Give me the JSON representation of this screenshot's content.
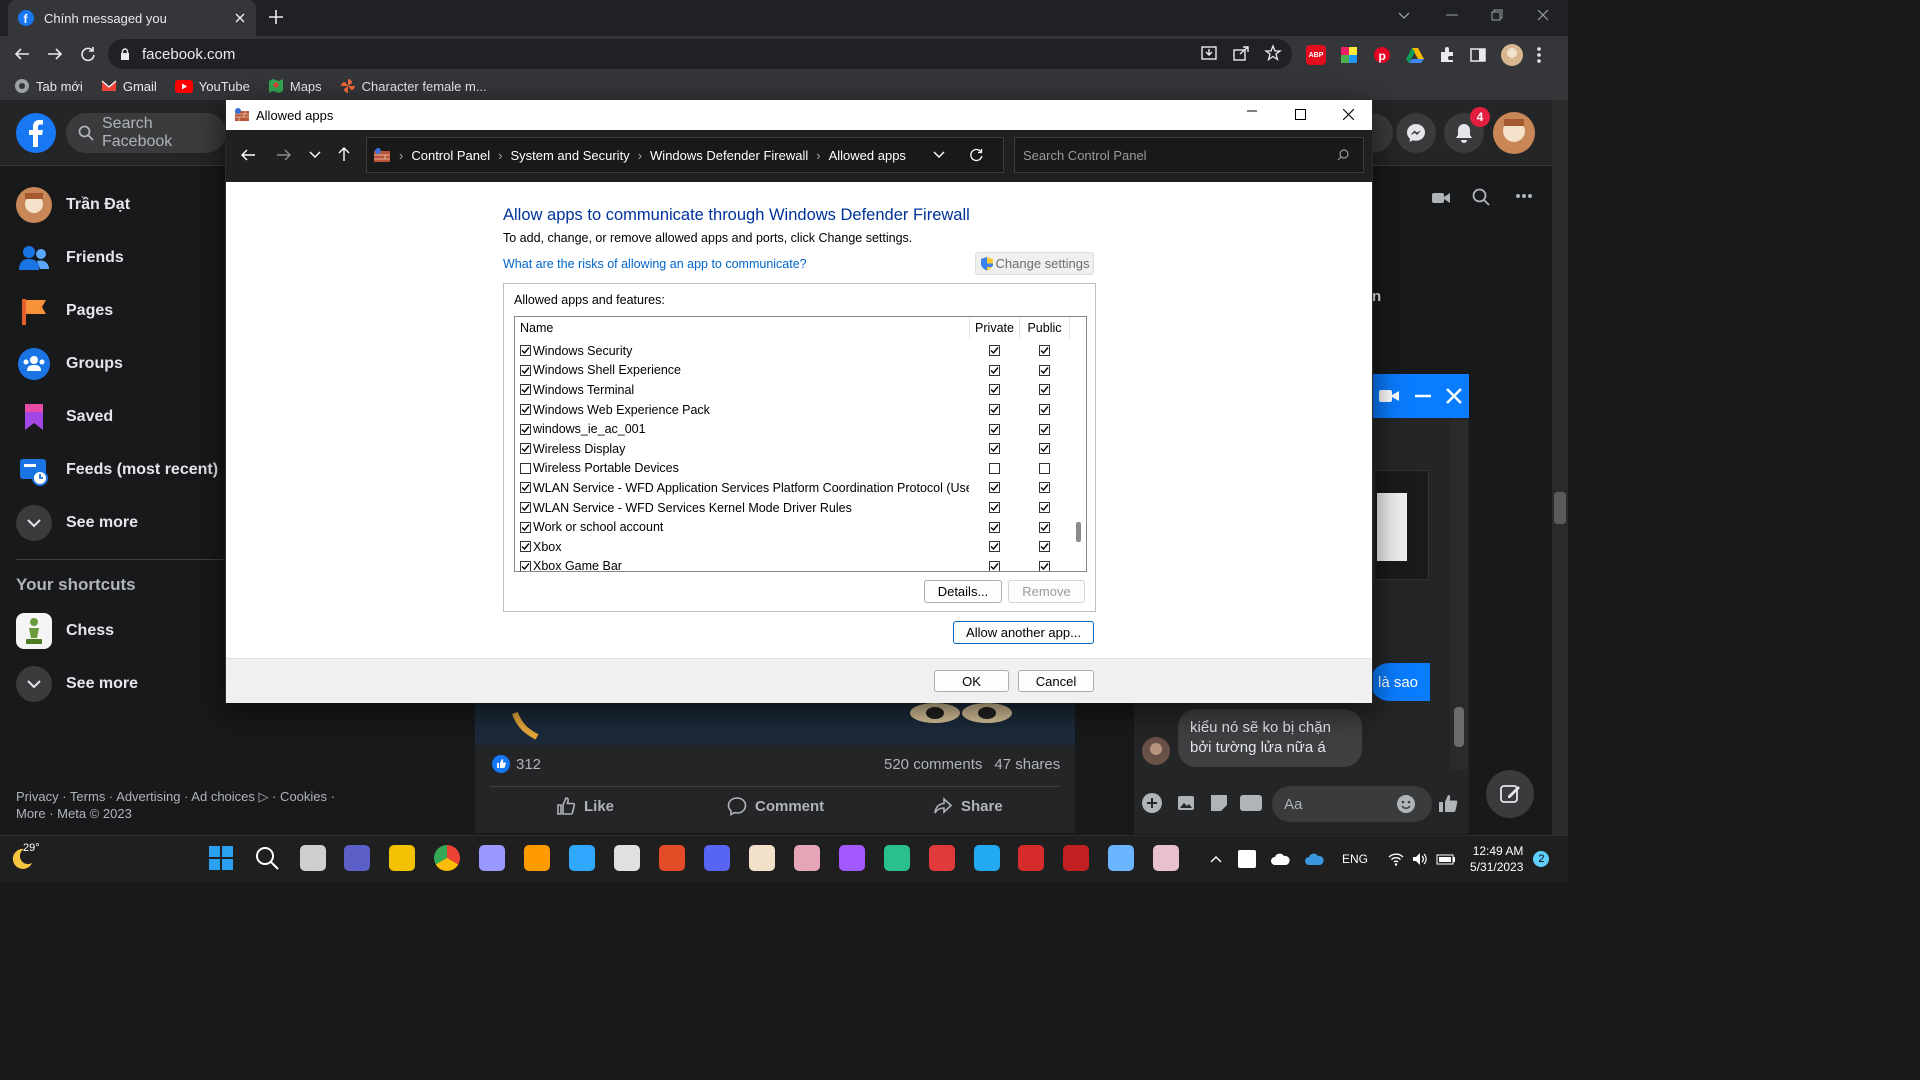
{
  "browser": {
    "tab_title": "Chính messaged you",
    "url": "facebook.com",
    "bookmarks": [
      "Tab mới",
      "Gmail",
      "YouTube",
      "Maps",
      "Character female m..."
    ],
    "extension_badge_abp": "ABP"
  },
  "facebook": {
    "search_placeholder": "Search Facebook",
    "notification_count": "4",
    "sidebar": {
      "items": [
        {
          "label": "Trần Đạt",
          "icon": "avatar"
        },
        {
          "label": "Friends",
          "icon": "friends-icon"
        },
        {
          "label": "Pages",
          "icon": "pages-icon"
        },
        {
          "label": "Groups",
          "icon": "groups-icon"
        },
        {
          "label": "Saved",
          "icon": "saved-icon"
        },
        {
          "label": "Feeds (most recent)",
          "icon": "feeds-icon"
        },
        {
          "label": "See more",
          "icon": "chevron-down-icon"
        }
      ],
      "shortcuts_title": "Your shortcuts",
      "shortcuts": [
        {
          "label": "Chess",
          "icon": "chess-icon"
        },
        {
          "label": "See more",
          "icon": "chevron-down-icon"
        }
      ],
      "footer": "Privacy · Terms · Advertising · Ad choices ▷ · Cookies · More · Meta © 2023"
    },
    "post": {
      "likes": "312",
      "comments": "520 comments",
      "shares": "47 shares",
      "actions": [
        "Like",
        "Comment",
        "Share"
      ]
    },
    "chat": {
      "partial_text": "n",
      "my_message": "là sao",
      "their_message": "kiểu nó sẽ ko bị chặn bởi tường lửa nữa á",
      "input_placeholder": "Aa"
    }
  },
  "dialog": {
    "window_title": "Allowed apps",
    "breadcrumb": [
      "Control Panel",
      "System and Security",
      "Windows Defender Firewall",
      "Allowed apps"
    ],
    "search_placeholder": "Search Control Panel",
    "heading": "Allow apps to communicate through Windows Defender Firewall",
    "description": "To add, change, or remove allowed apps and ports, click Change settings.",
    "risk_link": "What are the risks of allowing an app to communicate?",
    "change_settings": "Change settings",
    "group_label": "Allowed apps and features:",
    "columns": {
      "name": "Name",
      "private": "Private",
      "public": "Public"
    },
    "apps": [
      {
        "name": "Windows Security",
        "enabled": true,
        "private": true,
        "public": true
      },
      {
        "name": "Windows Shell Experience",
        "enabled": true,
        "private": true,
        "public": true
      },
      {
        "name": "Windows Terminal",
        "enabled": true,
        "private": true,
        "public": true
      },
      {
        "name": "Windows Web Experience Pack",
        "enabled": true,
        "private": true,
        "public": true
      },
      {
        "name": "windows_ie_ac_001",
        "enabled": true,
        "private": true,
        "public": true
      },
      {
        "name": "Wireless Display",
        "enabled": true,
        "private": true,
        "public": true
      },
      {
        "name": "Wireless Portable Devices",
        "enabled": false,
        "private": false,
        "public": false
      },
      {
        "name": "WLAN Service - WFD Application Services Platform Coordination Protocol (Use...",
        "enabled": true,
        "private": true,
        "public": true
      },
      {
        "name": "WLAN Service - WFD Services Kernel Mode Driver Rules",
        "enabled": true,
        "private": true,
        "public": true
      },
      {
        "name": "Work or school account",
        "enabled": true,
        "private": true,
        "public": true
      },
      {
        "name": "Xbox",
        "enabled": true,
        "private": true,
        "public": true
      },
      {
        "name": "Xbox Game Bar",
        "enabled": true,
        "private": true,
        "public": true
      }
    ],
    "buttons": {
      "details": "Details...",
      "remove": "Remove",
      "allow_another": "Allow another app...",
      "ok": "OK",
      "cancel": "Cancel"
    }
  },
  "taskbar": {
    "weather": "29°",
    "apps": [
      "start",
      "search",
      "task-view",
      "meet",
      "file-explorer",
      "chrome",
      "after-effects",
      "illustrator",
      "photoshop",
      "app-1",
      "app-2",
      "discord",
      "app-3",
      "app-4",
      "figma",
      "app-5",
      "app-6",
      "vscode",
      "wps",
      "app-7",
      "control-panel",
      "app-8"
    ],
    "language": "ENG",
    "time": "12:49 AM",
    "date": "5/31/2023",
    "notification_count": "2"
  },
  "colors": {
    "fb_blue": "#0a7cff",
    "dialog_heading": "#003399",
    "link": "#0066cc"
  }
}
